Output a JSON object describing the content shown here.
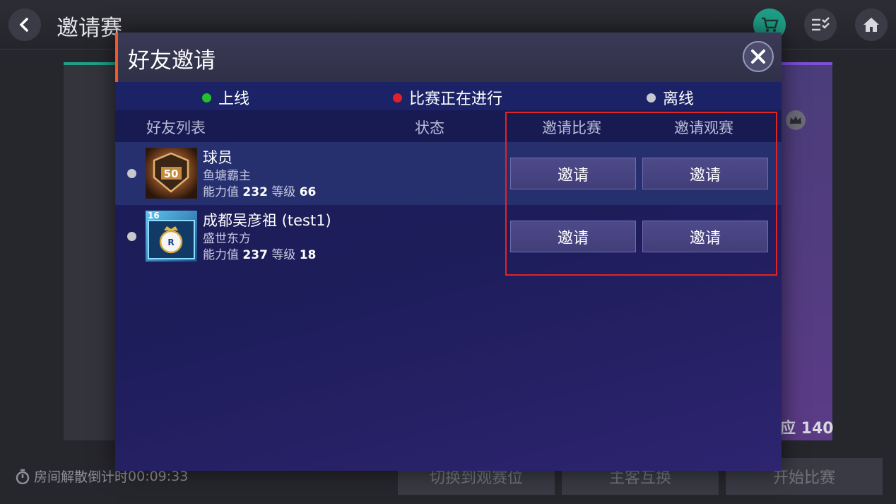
{
  "page": {
    "title": "邀请赛",
    "timer_label": "房间解散倒计时",
    "timer_value": "00:09:33",
    "power_text": "应 140",
    "bottom_buttons": [
      "切换到观赛位",
      "主客互换",
      "开始比赛"
    ]
  },
  "modal": {
    "title": "好友邀请",
    "legend": [
      {
        "label": "上线",
        "color": "#22c02a"
      },
      {
        "label": "比赛正在进行",
        "color": "#e0202a"
      },
      {
        "label": "离线",
        "color": "#c7c7cf"
      }
    ],
    "columns": {
      "friends": "好友列表",
      "status": "状态",
      "invite_match": "邀请比赛",
      "invite_watch": "邀请观赛"
    },
    "rows": [
      {
        "name": "球员",
        "club": "鱼塘霸主",
        "power_label": "能力值",
        "power": "232",
        "level_label": "等级",
        "level": "66",
        "avatar_text": "50",
        "invite_match": "邀请",
        "invite_watch": "邀请"
      },
      {
        "name": "成都吴彦祖 (test1)",
        "club": "盛世东方",
        "power_label": "能力值",
        "power": "237",
        "level_label": "等级",
        "level": "18",
        "avatar_text": "16",
        "invite_match": "邀请",
        "invite_watch": "邀请"
      }
    ]
  },
  "colors": {
    "accent": "#f05a28",
    "highlight": "#e02424",
    "modal_bg": "#1d1d5a"
  }
}
